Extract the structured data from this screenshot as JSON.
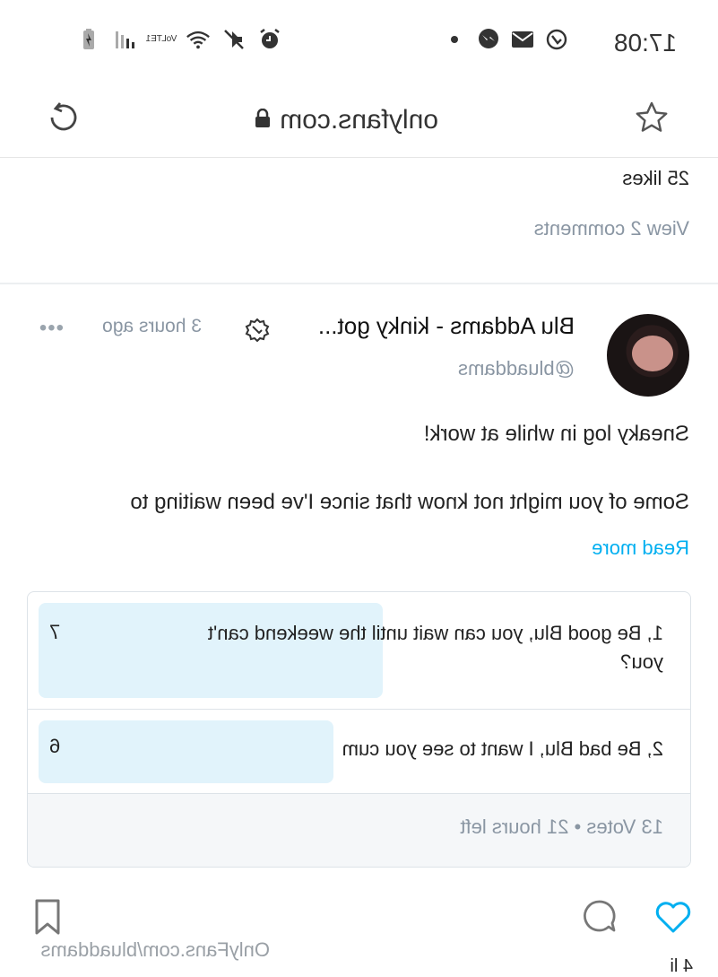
{
  "status_bar": {
    "time": "17:08",
    "notification_icons": [
      "clock-check-icon",
      "mail-icon",
      "messenger-icon",
      "dot-icon"
    ],
    "system_icons": [
      "alarm-icon",
      "mute-icon",
      "wifi-icon",
      "volte-lte-icon",
      "signal-icon",
      "battery-charging-icon"
    ],
    "volte_label": "VoLTE1"
  },
  "browser": {
    "url": "onlyfans.com"
  },
  "previous_post": {
    "likes": "25 likes",
    "view_comments": "View 2 comments"
  },
  "post": {
    "author": "Blu Addams - kinky got...",
    "handle": "@bluaddams",
    "time": "3 hours ago",
    "more": "•••",
    "text_line1": "Sneaky log in while at work!",
    "text_line2": "Some of you might not know that since I've been waiting to",
    "read_more": "Read more",
    "poll": {
      "options": [
        {
          "label": "1, Be good Blu, you can wait until the weekend can't you?",
          "votes": "7",
          "share": 0.54
        },
        {
          "label": "2, Be bad Blu, I want to see you cum",
          "votes": "6",
          "share": 0.46
        }
      ],
      "footer": "13 Votes • 21 hours left"
    }
  },
  "watermark": "OnlyFans.com/bluaddams",
  "likes_partial": "4 li",
  "colors": {
    "accent": "#00aff0",
    "muted": "#8a96a3",
    "poll_fill": "#e1f3fb"
  }
}
